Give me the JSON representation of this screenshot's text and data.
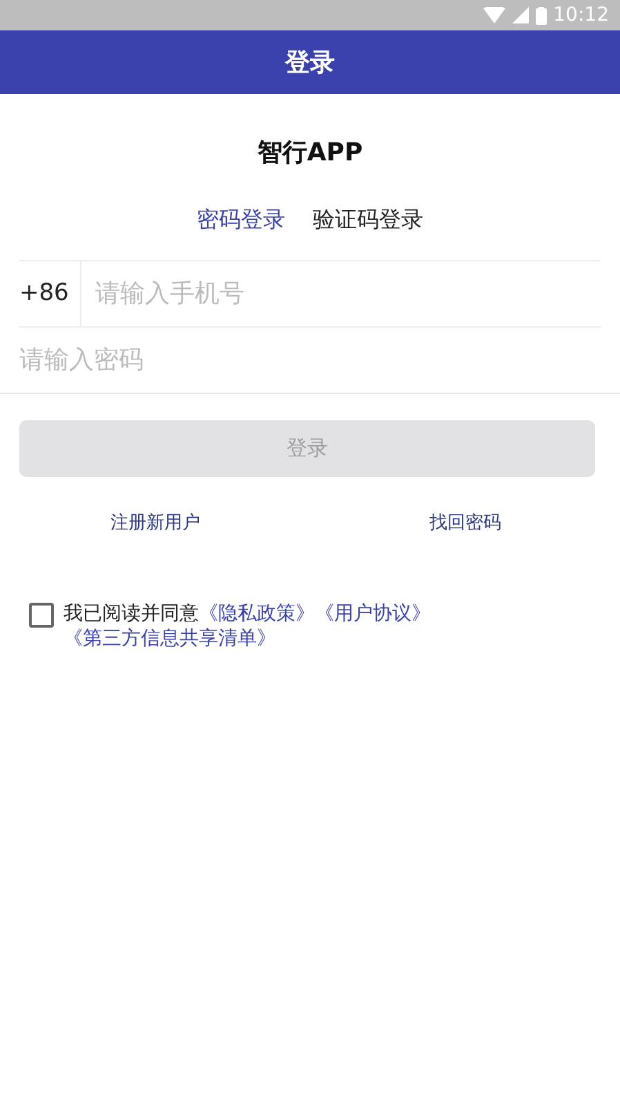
{
  "status_bar": {
    "time": "10:12"
  },
  "app_bar": {
    "title": "登录"
  },
  "app_name": "智行APP",
  "tabs": [
    {
      "label": "密码登录",
      "selected": true
    },
    {
      "label": "验证码登录",
      "selected": false
    }
  ],
  "phone_field": {
    "prefix": "+86",
    "placeholder": "请输入手机号"
  },
  "password_field": {
    "placeholder": "请输入密码"
  },
  "login_button": {
    "label": "登录",
    "disabled": true
  },
  "links": [
    "注册新用户",
    "找回密码"
  ],
  "agreement": {
    "checked": false,
    "text": "我已阅读并同意",
    "links": [
      "《隐私政策》",
      "《用户协议》",
      "《第三方信息共享清单》"
    ]
  }
}
